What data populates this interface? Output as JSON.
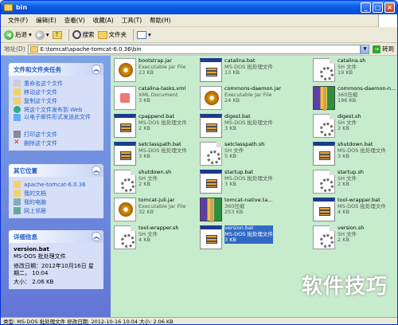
{
  "window": {
    "title": "bin"
  },
  "menu": [
    "文件(F)",
    "编辑(E)",
    "查看(V)",
    "收藏(A)",
    "工具(T)",
    "帮助(H)"
  ],
  "toolbar": {
    "back": "后退",
    "search": "搜索",
    "folders": "文件夹"
  },
  "address": {
    "label": "地址(D)",
    "path": "E:\\tomcat\\apache-tomcat-6.0.36\\bin",
    "go": "转到"
  },
  "tasks": {
    "title": "文件和文件夹任务",
    "items": [
      "重命名这个文件",
      "移动这个文件",
      "复制这个文件",
      "将这个文件发布到 Web",
      "以电子邮件形式发送此文件",
      "打印这个文件",
      "删除这个文件"
    ]
  },
  "places": {
    "title": "其它位置",
    "items": [
      "apache-tomcat-6.0.36",
      "我的文档",
      "我的电脑",
      "网上邻居"
    ]
  },
  "details": {
    "title": "详细信息",
    "name": "version.bat",
    "type": "MS-DOS 批处理文件",
    "modified_label": "修改日期：",
    "modified": "2012年10月16日 星期二， 10:04",
    "size": "大小： 2.06 KB"
  },
  "files": [
    {
      "name": "bootstrap.jar",
      "type": "Executable Jar File",
      "size": "23 KB",
      "icon": "jar"
    },
    {
      "name": "catalina.bat",
      "type": "MS-DOS 批处理文件",
      "size": "13 KB",
      "icon": "bat"
    },
    {
      "name": "catalina.sh",
      "type": "SH 文件",
      "size": "19 KB",
      "icon": "sh"
    },
    {
      "name": "catalina-tasks.xml",
      "type": "XML Document",
      "size": "3 KB",
      "icon": "xml"
    },
    {
      "name": "commons-daemon.jar",
      "type": "Executable Jar File",
      "size": "24 KB",
      "icon": "jar"
    },
    {
      "name": "commons-daemon-n...",
      "type": "360压缩",
      "size": "196 KB",
      "icon": "rar"
    },
    {
      "name": "cpappend.bat",
      "type": "MS-DOS 批处理文件",
      "size": "2 KB",
      "icon": "bat"
    },
    {
      "name": "digest.bat",
      "type": "MS-DOS 批处理文件",
      "size": "3 KB",
      "icon": "bat"
    },
    {
      "name": "digest.sh",
      "type": "SH 文件",
      "size": "2 KB",
      "icon": "sh"
    },
    {
      "name": "setclasspath.bat",
      "type": "MS-DOS 批处理文件",
      "size": "3 KB",
      "icon": "bat"
    },
    {
      "name": "setclasspath.sh",
      "type": "SH 文件",
      "size": "5 KB",
      "icon": "sh"
    },
    {
      "name": "shutdown.bat",
      "type": "MS-DOS 批处理文件",
      "size": "3 KB",
      "icon": "bat"
    },
    {
      "name": "shutdown.sh",
      "type": "SH 文件",
      "size": "2 KB",
      "icon": "sh"
    },
    {
      "name": "startup.bat",
      "type": "MS-DOS 批处理文件",
      "size": "3 KB",
      "icon": "bat"
    },
    {
      "name": "startup.sh",
      "type": "SH 文件",
      "size": "2 KB",
      "icon": "sh"
    },
    {
      "name": "tomcat-juli.jar",
      "type": "Executable Jar File",
      "size": "32 KB",
      "icon": "jar"
    },
    {
      "name": "tomcat-native.ta...",
      "type": "360压缩",
      "size": "253 KB",
      "icon": "rar"
    },
    {
      "name": "tool-wrapper.bat",
      "type": "MS-DOS 批处理文件",
      "size": "4 KB",
      "icon": "bat"
    },
    {
      "name": "tool-wrapper.sh",
      "type": "SH 文件",
      "size": "4 KB",
      "icon": "sh"
    },
    {
      "name": "version.bat",
      "type": "MS-DOS 批处理文件",
      "size": "3 KB",
      "icon": "bat",
      "selected": true
    },
    {
      "name": "version.sh",
      "type": "SH 文件",
      "size": "2 KB",
      "icon": "sh"
    }
  ],
  "status": "类型: MS-DOS 批处理文件 修改日期: 2012-10-16 10:04 大小: 2.06 KB",
  "watermark": "软件技巧"
}
